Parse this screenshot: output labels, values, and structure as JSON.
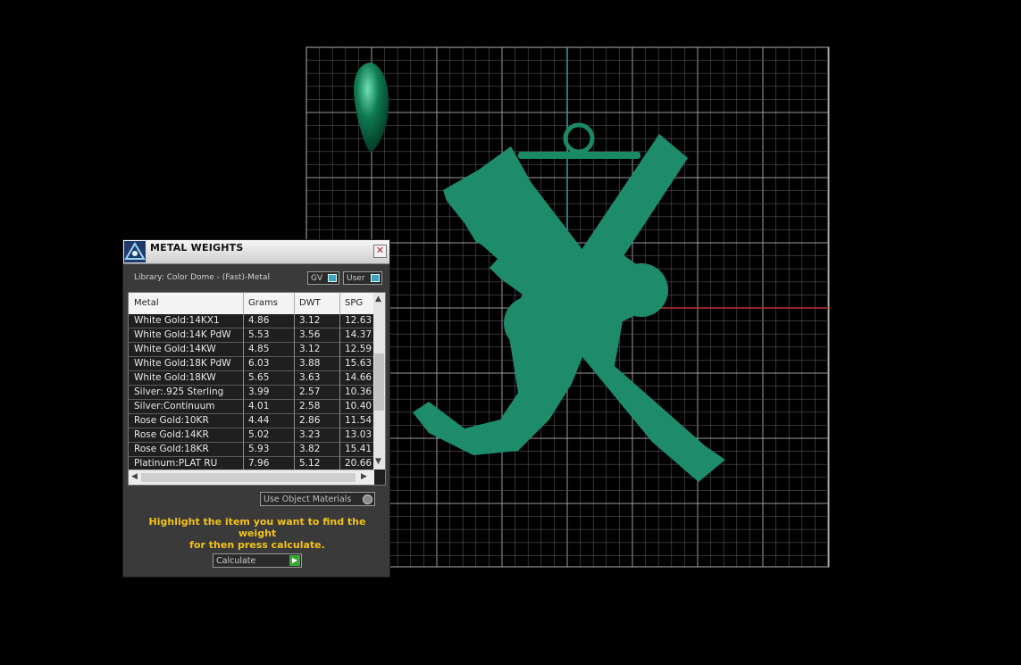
{
  "panel": {
    "title": "METAL WEIGHTS",
    "close_glyph": "✕",
    "library_label": "Library: Color Dome - (Fast)-Metal",
    "gv_label": "GV",
    "user_label": "User",
    "columns": [
      "Metal",
      "Grams",
      "DWT",
      "SPG"
    ],
    "rows": [
      [
        "White Gold:14KX1",
        "4.86",
        "3.12",
        "12.63"
      ],
      [
        "White Gold:14K PdW",
        "5.53",
        "3.56",
        "14.37"
      ],
      [
        "White Gold:14KW",
        "4.85",
        "3.12",
        "12.59"
      ],
      [
        "White Gold:18K PdW",
        "6.03",
        "3.88",
        "15.63"
      ],
      [
        "White Gold:18KW",
        "5.65",
        "3.63",
        "14.66"
      ],
      [
        "Silver:.925 Sterling",
        "3.99",
        "2.57",
        "10.36"
      ],
      [
        "Silver:Continuum",
        "4.01",
        "2.58",
        "10.40"
      ],
      [
        "Rose Gold:10KR",
        "4.44",
        "2.86",
        "11.54"
      ],
      [
        "Rose Gold:14KR",
        "5.02",
        "3.23",
        "13.03"
      ],
      [
        "Rose Gold:18KR",
        "5.93",
        "3.82",
        "15.41"
      ],
      [
        "Platinum:PLAT RU",
        "7.96",
        "5.12",
        "20.66"
      ]
    ],
    "use_materials_label": "Use Object Materials",
    "hint_line1": "Highlight the item you want to find the weight",
    "hint_line2": "for then press calculate.",
    "calculate_label": "Calculate"
  },
  "colors": {
    "model_green": "#1e8c6a",
    "hint_yellow": "#f2c21b",
    "axis_red": "#c0302a",
    "axis_cyan": "#2f9fae",
    "grid": "#7a7a7a"
  },
  "icons": {
    "app": "triangle-logo-icon",
    "close": "close-icon",
    "toggle": "toggle-icon",
    "play": "play-icon",
    "scroll_up": "chevron-up-icon",
    "scroll_down": "chevron-down-icon",
    "scroll_left": "chevron-left-icon",
    "scroll_right": "chevron-right-icon"
  }
}
